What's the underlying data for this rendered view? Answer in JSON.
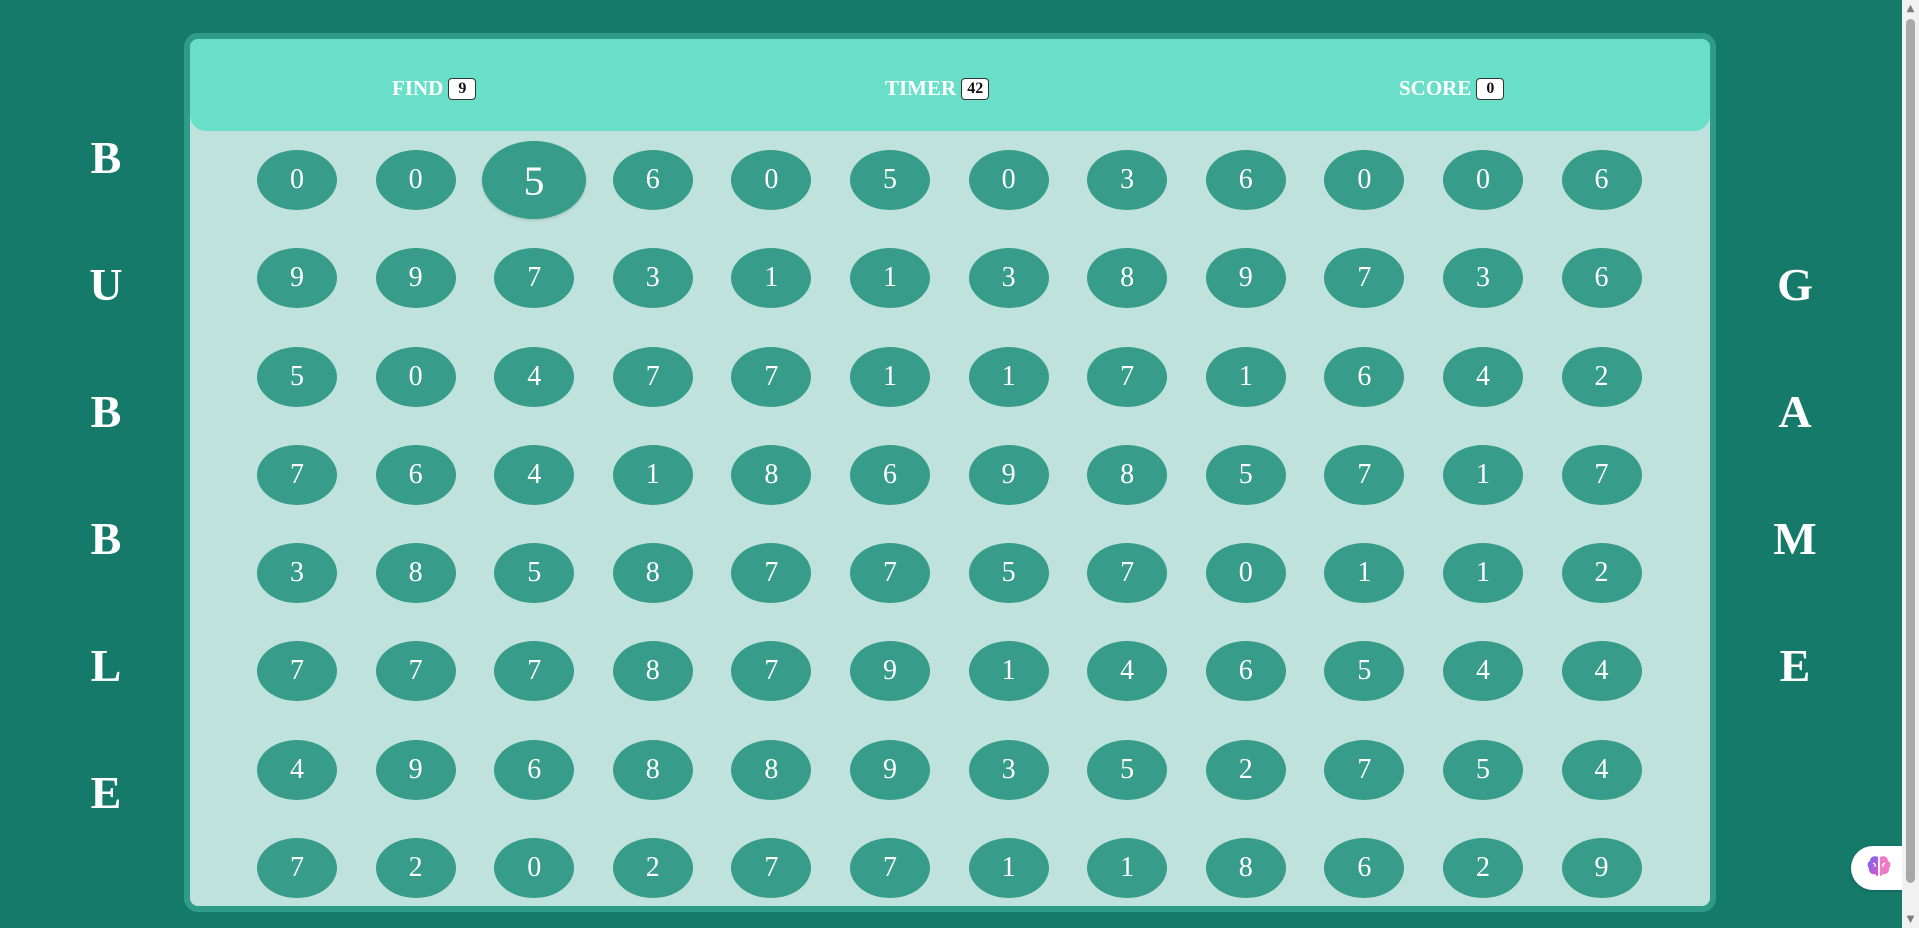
{
  "title_left": [
    "B",
    "U",
    "B",
    "B",
    "L",
    "E"
  ],
  "title_right": [
    "G",
    "A",
    "M",
    "E"
  ],
  "header": {
    "find_label": "FIND",
    "find_value": "9",
    "timer_label": "TIMER",
    "timer_value": "42",
    "score_label": "SCORE",
    "score_value": "0"
  },
  "grid": [
    [
      "0",
      "0",
      "5",
      "6",
      "0",
      "5",
      "0",
      "3",
      "6",
      "0",
      "0",
      "6"
    ],
    [
      "9",
      "9",
      "7",
      "3",
      "1",
      "1",
      "3",
      "8",
      "9",
      "7",
      "3",
      "6"
    ],
    [
      "5",
      "0",
      "4",
      "7",
      "7",
      "1",
      "1",
      "7",
      "1",
      "6",
      "4",
      "2"
    ],
    [
      "7",
      "6",
      "4",
      "1",
      "8",
      "6",
      "9",
      "8",
      "5",
      "7",
      "1",
      "7"
    ],
    [
      "3",
      "8",
      "5",
      "8",
      "7",
      "7",
      "5",
      "7",
      "0",
      "1",
      "1",
      "2"
    ],
    [
      "7",
      "7",
      "7",
      "8",
      "7",
      "9",
      "1",
      "4",
      "6",
      "5",
      "4",
      "4"
    ],
    [
      "4",
      "9",
      "6",
      "8",
      "8",
      "9",
      "3",
      "5",
      "2",
      "7",
      "5",
      "4"
    ],
    [
      "7",
      "2",
      "0",
      "2",
      "7",
      "7",
      "1",
      "1",
      "8",
      "6",
      "2",
      "9"
    ]
  ],
  "hovered_bubble": [
    0,
    2
  ],
  "icons": {
    "assistant": "brain-icon",
    "scroll_up": "scroll-up-arrow-icon",
    "scroll_down": "scroll-down-arrow-icon"
  },
  "colors": {
    "background": "#157a6a",
    "panel": "#bfe2dc",
    "header": "#69dfc9",
    "bubble": "#379c89",
    "text": "#ffffff"
  }
}
